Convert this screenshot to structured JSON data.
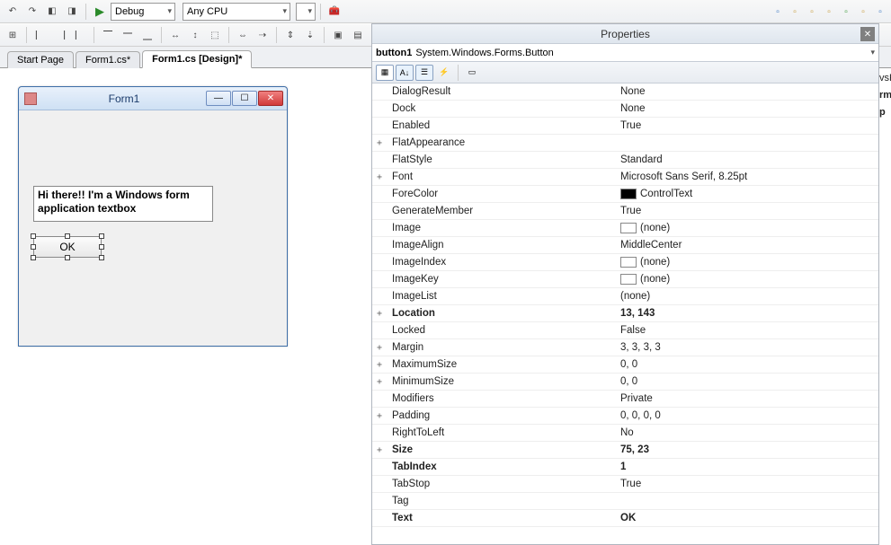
{
  "toolbar1": {
    "config": "Debug",
    "platform": "Any CPU"
  },
  "tabs": [
    {
      "label": "Start Page",
      "active": false
    },
    {
      "label": "Form1.cs*",
      "active": false
    },
    {
      "label": "Form1.cs [Design]*",
      "active": true
    }
  ],
  "form": {
    "title": "Form1",
    "textbox_text": "Hi there!! I'm a Windows form application textbox",
    "button_text": "OK"
  },
  "properties": {
    "panel_title": "Properties",
    "object_name": "button1",
    "object_type": "System.Windows.Forms.Button",
    "rows": [
      {
        "exp": "",
        "name": "DialogResult",
        "value": "None"
      },
      {
        "exp": "",
        "name": "Dock",
        "value": "None"
      },
      {
        "exp": "",
        "name": "Enabled",
        "value": "True"
      },
      {
        "exp": "+",
        "name": "FlatAppearance",
        "value": ""
      },
      {
        "exp": "",
        "name": "FlatStyle",
        "value": "Standard"
      },
      {
        "exp": "+",
        "name": "Font",
        "value": "Microsoft Sans Serif, 8.25pt"
      },
      {
        "exp": "",
        "name": "ForeColor",
        "value": "ControlText",
        "swatch": "#000000"
      },
      {
        "exp": "",
        "name": "GenerateMember",
        "value": "True"
      },
      {
        "exp": "",
        "name": "Image",
        "value": "(none)",
        "swatch": "#ffffff"
      },
      {
        "exp": "",
        "name": "ImageAlign",
        "value": "MiddleCenter"
      },
      {
        "exp": "",
        "name": "ImageIndex",
        "value": "(none)",
        "swatch": "#ffffff"
      },
      {
        "exp": "",
        "name": "ImageKey",
        "value": "(none)",
        "swatch": "#ffffff"
      },
      {
        "exp": "",
        "name": "ImageList",
        "value": "(none)"
      },
      {
        "exp": "+",
        "name": "Location",
        "value": "13, 143",
        "bold": true
      },
      {
        "exp": "",
        "name": "Locked",
        "value": "False"
      },
      {
        "exp": "+",
        "name": "Margin",
        "value": "3, 3, 3, 3"
      },
      {
        "exp": "+",
        "name": "MaximumSize",
        "value": "0, 0"
      },
      {
        "exp": "+",
        "name": "MinimumSize",
        "value": "0, 0"
      },
      {
        "exp": "",
        "name": "Modifiers",
        "value": "Private"
      },
      {
        "exp": "+",
        "name": "Padding",
        "value": "0, 0, 0, 0"
      },
      {
        "exp": "",
        "name": "RightToLeft",
        "value": "No"
      },
      {
        "exp": "+",
        "name": "Size",
        "value": "75, 23",
        "bold": true
      },
      {
        "exp": "",
        "name": "TabIndex",
        "value": "1",
        "bold": true
      },
      {
        "exp": "",
        "name": "TabStop",
        "value": "True"
      },
      {
        "exp": "",
        "name": "Tag",
        "value": ""
      },
      {
        "exp": "",
        "name": "Text",
        "value": "OK",
        "bold": true
      }
    ]
  },
  "peek": {
    "line1": "vsFo",
    "line2": "rmA",
    "line3": "p"
  }
}
